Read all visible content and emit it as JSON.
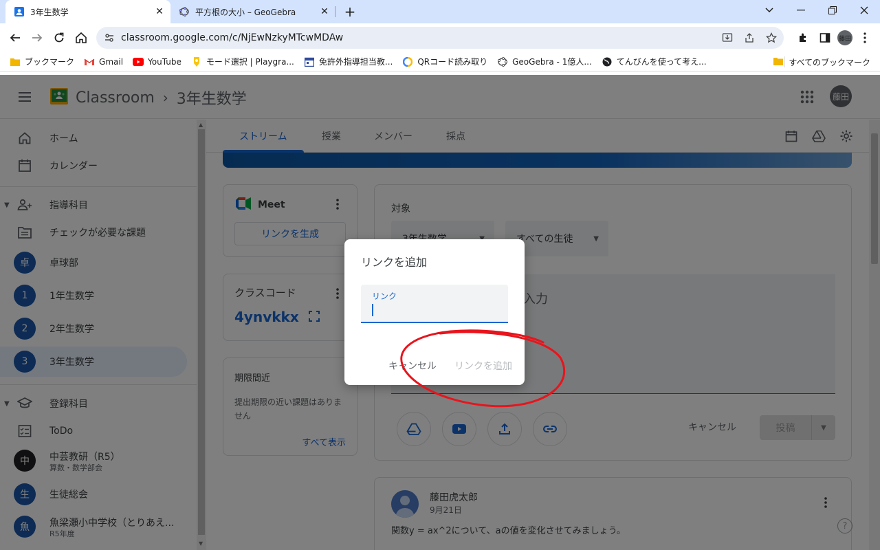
{
  "browser": {
    "tabs": [
      {
        "title": "3年生数学"
      },
      {
        "title": "平方根の大小 – GeoGebra"
      }
    ],
    "url": "classroom.google.com/c/NjEwNzkyMTcwMDAw",
    "profile": "藤田",
    "bookmarks": [
      {
        "label": "ブックマーク",
        "icon": "folder-icon"
      },
      {
        "label": "Gmail",
        "icon": "gmail-icon"
      },
      {
        "label": "YouTube",
        "icon": "youtube-icon"
      },
      {
        "label": "モード選択 | Playgra...",
        "icon": "playground-icon"
      },
      {
        "label": "免許外指導担当教...",
        "icon": "calendar-icon"
      },
      {
        "label": "QRコード読み取り",
        "icon": "qr-icon"
      },
      {
        "label": "GeoGebra - 1億人...",
        "icon": "geogebra-icon"
      },
      {
        "label": "てんびんを使って考え...",
        "icon": "globe-icon"
      }
    ],
    "all_bookmarks": "すべてのブックマーク"
  },
  "header": {
    "app": "Classroom",
    "class_name": "3年生数学",
    "avatar": "藤田"
  },
  "sidebar": {
    "home": "ホーム",
    "calendar": "カレンダー",
    "teaching_section": "指導科目",
    "review": "チェックが必要な課題",
    "classes": [
      {
        "badge": "卓",
        "label": "卓球部",
        "color": "#1a56a8"
      },
      {
        "badge": "1",
        "label": "1年生数学",
        "color": "#1a56a8"
      },
      {
        "badge": "2",
        "label": "2年生数学",
        "color": "#1a56a8"
      },
      {
        "badge": "3",
        "label": "3年生数学",
        "color": "#1a56a8"
      }
    ],
    "enrolled_section": "登録科目",
    "todo": "ToDo",
    "enrolled": [
      {
        "badge": "中",
        "label": "中芸教研（R5）",
        "sub": "算数・数学部会",
        "color": "#202124"
      },
      {
        "badge": "生",
        "label": "生徒総会",
        "sub": "",
        "color": "#1a56a8"
      },
      {
        "badge": "魚",
        "label": "魚梁瀬小中学校（とりあえ...",
        "sub": "R5年度",
        "color": "#1a56a8"
      }
    ]
  },
  "main": {
    "tabs": [
      "ストリーム",
      "授業",
      "メンバー",
      "採点"
    ],
    "meet": {
      "title": "Meet",
      "button": "リンクを生成"
    },
    "class_code": {
      "title": "クラスコード",
      "code": "4ynvkkx"
    },
    "due": {
      "title": "期限間近",
      "text": "提出期限の近い課題はありません",
      "link": "すべて表示"
    },
    "compose": {
      "target_label": "対象",
      "class_select": "3年生数学",
      "students_select": "すべての生徒",
      "placeholder": "入力",
      "cancel": "キャンセル",
      "post": "投稿"
    },
    "post": {
      "author": "藤田虎太郎",
      "date": "9月21日",
      "body": "関数y = ax^2について、aの値を変化させてみましょう。"
    }
  },
  "dialog": {
    "title": "リンクを追加",
    "field_label": "リンク",
    "field_value": "",
    "cancel": "キャンセル",
    "add": "リンクを追加"
  },
  "colors": {
    "accent": "#1967d2",
    "annotation": "#e8141c"
  }
}
